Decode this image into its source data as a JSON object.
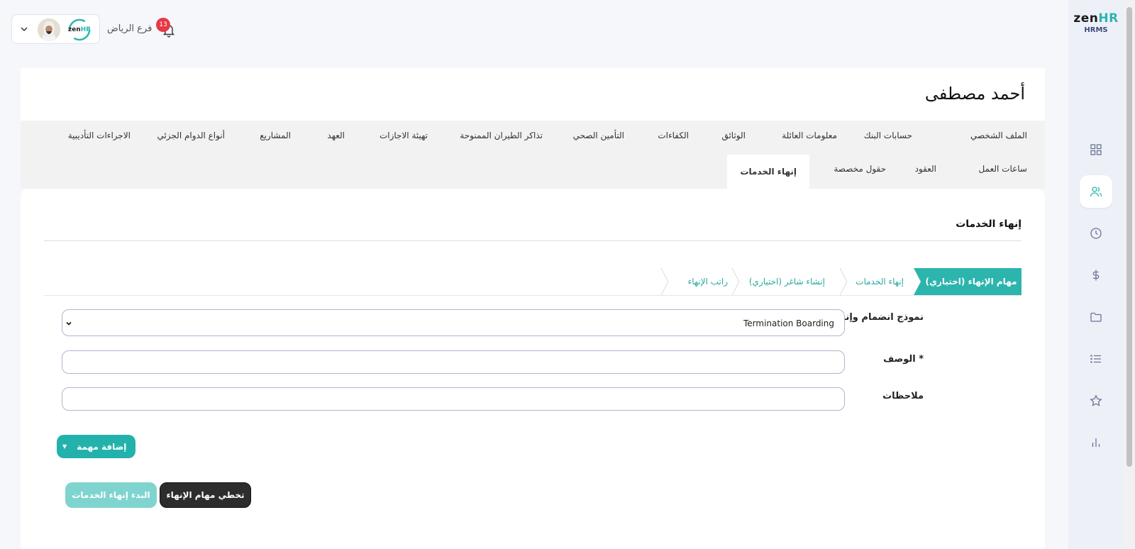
{
  "app": {
    "logo_main": "zen",
    "logo_hr": "HR",
    "logo_sub": "HRMS"
  },
  "topbar": {
    "branch": "فرع الرياض",
    "notifications_count": "13",
    "badge_zen": "zen",
    "badge_hr": "HR"
  },
  "employee": {
    "name": "أحمد مصطفى"
  },
  "tabs": [
    "الملف الشخصي",
    "حسابات البنك",
    "معلومات العائلة",
    "الوثائق",
    "الكفاءات",
    "التأمين الصحي",
    "تذاكر الطيران الممنوحة",
    "تهيئة الاجازات",
    "العهد",
    "المشاريع",
    "أنواع الدوام الجزئي",
    "الاجراءات التأديبية",
    "ساعات العمل",
    "العقود",
    "حقول مخصصة",
    "إنهاء الخدمات"
  ],
  "active_tab": "إنهاء الخدمات",
  "section": {
    "title": "إنهاء الخدمات"
  },
  "steps": [
    "مهام الإنهاء (اختياري)",
    "إنهاء الخدمات",
    "إنشاء شاغر (اختياري)",
    "راتب الإنهاء"
  ],
  "form": {
    "template_label": "نموذج انضمام وإنهاء",
    "template_value": "Termination Boarding",
    "description_label": "الوصف *",
    "description_value": "",
    "notes_label": "ملاحظات",
    "notes_value": ""
  },
  "buttons": {
    "add_task": "إضافة مهمة",
    "skip": "تخطي مهام الإنهاء",
    "start": "البدء إنهاء الخدمات"
  },
  "colors": {
    "accent": "#2cb5ad",
    "badge": "#e53946",
    "dark_button": "#2d2d2d"
  }
}
